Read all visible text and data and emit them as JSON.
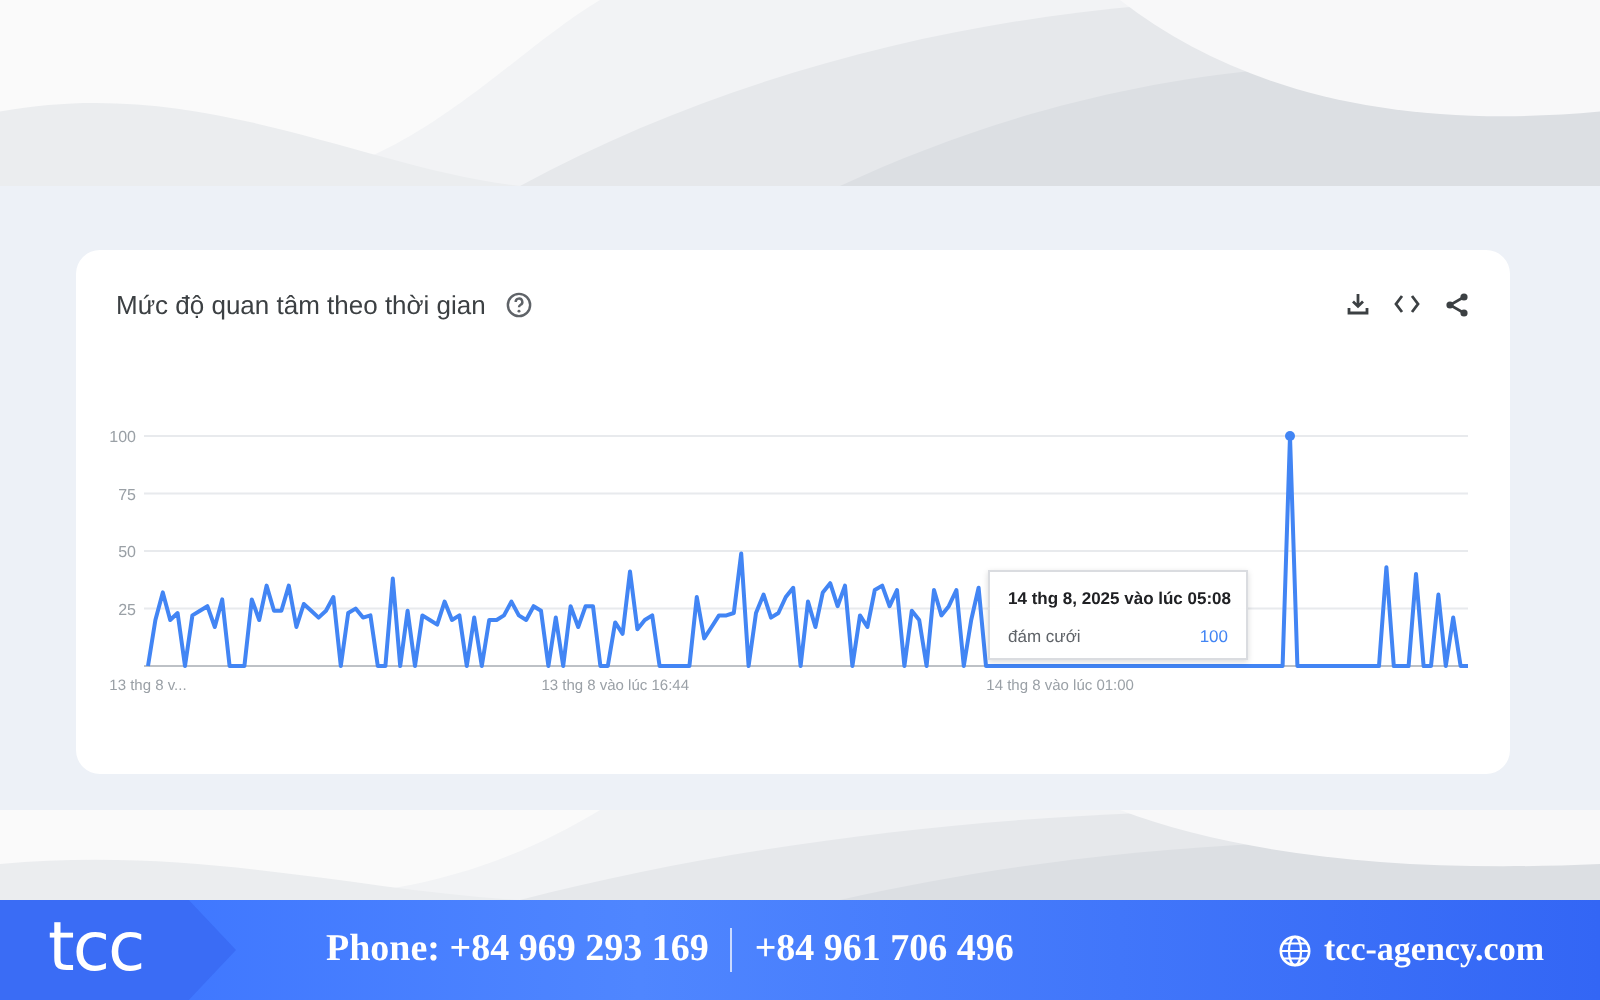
{
  "card": {
    "title": "Mức độ quan tâm theo thời gian",
    "chart_data": {
      "type": "line",
      "grid": true,
      "ylim": [
        0,
        100
      ],
      "yticks": [
        25,
        50,
        75,
        100
      ],
      "categories": [
        "13 thg 8 v...",
        null,
        null,
        null,
        null,
        null,
        null,
        null,
        null,
        null,
        null,
        null,
        null,
        null,
        null,
        null,
        null,
        null,
        null,
        null,
        null,
        null,
        null,
        null,
        null,
        null,
        null,
        null,
        null,
        null,
        null,
        null,
        null,
        null,
        null,
        null,
        null,
        null,
        null,
        null,
        null,
        null,
        null,
        null,
        null,
        null,
        null,
        null,
        null,
        null,
        null,
        null,
        null,
        null,
        null,
        null,
        null,
        null,
        null,
        null,
        null,
        null,
        null,
        "13 thg 8 vào lúc 16:44",
        null,
        null,
        null,
        null,
        null,
        null,
        null,
        null,
        null,
        null,
        null,
        null,
        null,
        null,
        null,
        null,
        null,
        null,
        null,
        null,
        null,
        null,
        null,
        null,
        null,
        null,
        null,
        null,
        null,
        null,
        null,
        null,
        null,
        null,
        null,
        null,
        null,
        null,
        null,
        null,
        null,
        null,
        null,
        null,
        null,
        null,
        null,
        null,
        null,
        null,
        null,
        null,
        null,
        null,
        null,
        null,
        null,
        null,
        null,
        "14 thg 8 vào lúc 01:00",
        null,
        null,
        null,
        null,
        null,
        null,
        null,
        null,
        null,
        null,
        null,
        null,
        null,
        null,
        null,
        null,
        null,
        null,
        null,
        null,
        null,
        null,
        null,
        null,
        null,
        null,
        null,
        null,
        null,
        null,
        null,
        null,
        null,
        null,
        null,
        null,
        null,
        null,
        null,
        null,
        null,
        null,
        null,
        null,
        null,
        null,
        null,
        null,
        null,
        null,
        null,
        null,
        null,
        null,
        null
      ],
      "series": [
        {
          "name": "đám cưới",
          "color": "#4285f4",
          "values": [
            0,
            20,
            32,
            20,
            23,
            0,
            22,
            24,
            26,
            17,
            29,
            0,
            0,
            0,
            29,
            20,
            35,
            24,
            24,
            35,
            17,
            27,
            24,
            21,
            24,
            30,
            0,
            23,
            25,
            21,
            22,
            0,
            0,
            38,
            0,
            24,
            0,
            22,
            20,
            18,
            28,
            20,
            22,
            0,
            21,
            0,
            20,
            20,
            22,
            28,
            22,
            20,
            26,
            24,
            0,
            21,
            0,
            26,
            17,
            26,
            26,
            0,
            0,
            19,
            14,
            41,
            16,
            20,
            22,
            0,
            0,
            0,
            0,
            0,
            30,
            12,
            17,
            22,
            22,
            23,
            49,
            0,
            23,
            31,
            21,
            23,
            30,
            34,
            0,
            28,
            17,
            32,
            36,
            26,
            35,
            0,
            22,
            17,
            33,
            35,
            26,
            33,
            0,
            24,
            20,
            0,
            33,
            22,
            26,
            33,
            0,
            20,
            34,
            0,
            0,
            0,
            0,
            0,
            0,
            0,
            0,
            0,
            0,
            0,
            0,
            0,
            0,
            0,
            0,
            0,
            0,
            0,
            0,
            0,
            0,
            0,
            0,
            0,
            0,
            0,
            0,
            0,
            0,
            0,
            0,
            0,
            0,
            0,
            0,
            0,
            0,
            0,
            0,
            0,
            100,
            0,
            0,
            0,
            0,
            0,
            0,
            0,
            0,
            0,
            0,
            0,
            0,
            43,
            0,
            0,
            0,
            40,
            0,
            0,
            31,
            0,
            21,
            0,
            0
          ]
        }
      ]
    },
    "tooltip": {
      "title": "14 thg 8, 2025 vào lúc 05:08",
      "value": "100"
    }
  },
  "footer": {
    "logo": "tcc",
    "phones": [
      "Phone: +84 969 293 169",
      "+84 961 706 496"
    ],
    "website": "tcc-agency.com"
  }
}
